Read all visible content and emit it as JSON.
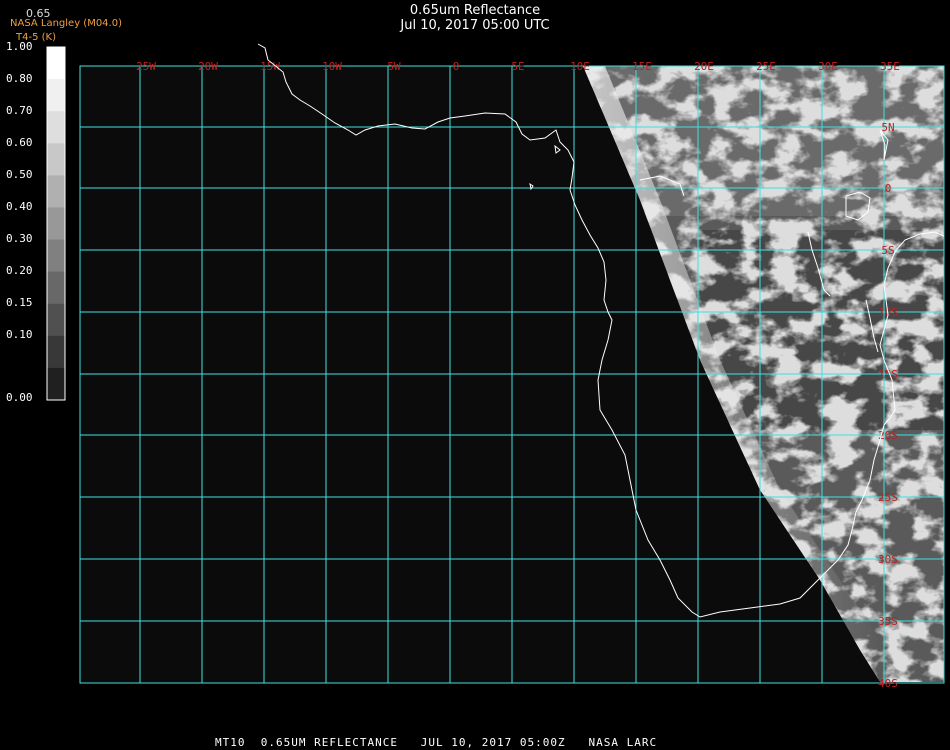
{
  "title": {
    "line1": "0.65um Reflectance",
    "line2": "Jul 10, 2017 05:00 UTC"
  },
  "corner": {
    "value": "0.65",
    "source": "NASA Langley (M04.0)",
    "sublabel": "T4-5 (K)"
  },
  "scale": {
    "labels": [
      "1.00",
      "0.80",
      "0.70",
      "0.60",
      "0.50",
      "0.40",
      "0.30",
      "0.20",
      "0.15",
      "0.10",
      "0.00"
    ]
  },
  "map": {
    "lon_labels": [
      "25W",
      "20W",
      "15W",
      "10W",
      "5W",
      "0",
      "5E",
      "10E",
      "15E",
      "20E",
      "25E",
      "30E",
      "35E"
    ],
    "lat_labels": [
      "5N",
      "0",
      "5S",
      "10S",
      "15S",
      "20S",
      "25S",
      "30S",
      "35S",
      "40S"
    ],
    "grid_color": "#40e0e0",
    "label_color": "#c02020",
    "coast_color": "#ffffff"
  },
  "footer": {
    "text": "MT10  0.65UM REFLECTANCE   JUL 10, 2017 05:00Z   NASA LARC"
  }
}
